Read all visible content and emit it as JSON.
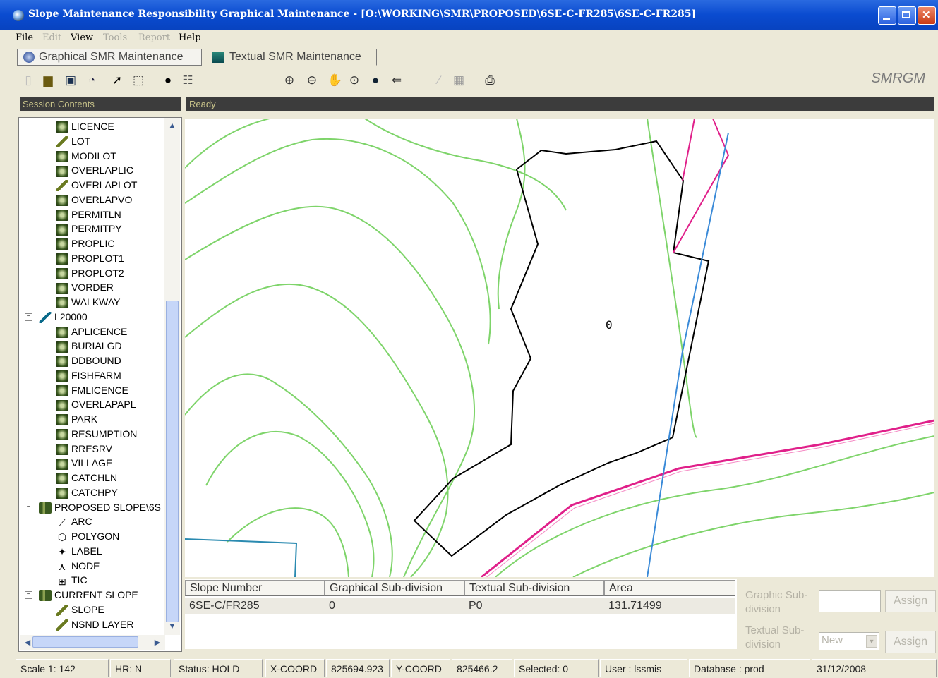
{
  "window": {
    "title": "Slope Maintenance Responsibility Graphical Maintenance - [O:\\WORKING\\SMR\\PROPOSED\\6SE-C-FR285\\6SE-C-FR285]"
  },
  "menu": {
    "file": "File",
    "edit": "Edit",
    "view": "View",
    "tools": "Tools",
    "report": "Report",
    "help": "Help"
  },
  "tabs": {
    "graphical": "Graphical SMR Maintenance",
    "textual": "Textual SMR Maintenance"
  },
  "app_code": "SMRGM",
  "panels": {
    "session": "Session Contents",
    "status_msg": "Ready"
  },
  "tree": {
    "items": [
      "LICENCE",
      "LOT",
      "MODILOT",
      "OVERLAPLIC",
      "OVERLAPLOT",
      "OVERLAPVO",
      "PERMITLN",
      "PERMITPY",
      "PROPLIC",
      "PROPLOT1",
      "PROPLOT2",
      "VORDER",
      "WALKWAY",
      "L20000",
      "APLICENCE",
      "BURIALGD",
      "DDBOUND",
      "FISHFARM",
      "FMLICENCE",
      "OVERLAPAPL",
      "PARK",
      "RESUMPTION",
      "RRESRV",
      "VILLAGE",
      "CATCHLN",
      "CATCHPY",
      "PROPOSED SLOPE\\6S",
      "ARC",
      "POLYGON",
      "LABEL",
      "NODE",
      "TIC",
      "CURRENT SLOPE",
      "SLOPE",
      "NSND LAYER"
    ]
  },
  "map": {
    "polygon_label": "0"
  },
  "grid": {
    "headers": [
      "Slope Number",
      "Graphical Sub-division",
      "Textual Sub-division",
      "Area"
    ],
    "row": [
      "6SE-C/FR285",
      "0",
      "P0",
      "131.71499"
    ]
  },
  "side": {
    "graphic_label": "Graphic Sub-division",
    "textual_label": "Textual Sub-division",
    "assign1": "Assign",
    "assign2": "Assign",
    "textual_value": "New"
  },
  "status": {
    "scale": "Scale 1: 142",
    "hr": "HR: N",
    "status": "Status: HOLD",
    "xcoord_label": "X-COORD",
    "xcoord_value": "825694.923",
    "ycoord_label": "Y-COORD",
    "ycoord_value": "825466.2",
    "selected": "Selected: 0",
    "user": "User : lssmis",
    "database": "Database : prod",
    "date": "31/12/2008"
  },
  "colors": {
    "contour": "#7ed46a",
    "boundary": "#000000",
    "pink": "#e0208a",
    "blue": "#3a8ad8"
  }
}
